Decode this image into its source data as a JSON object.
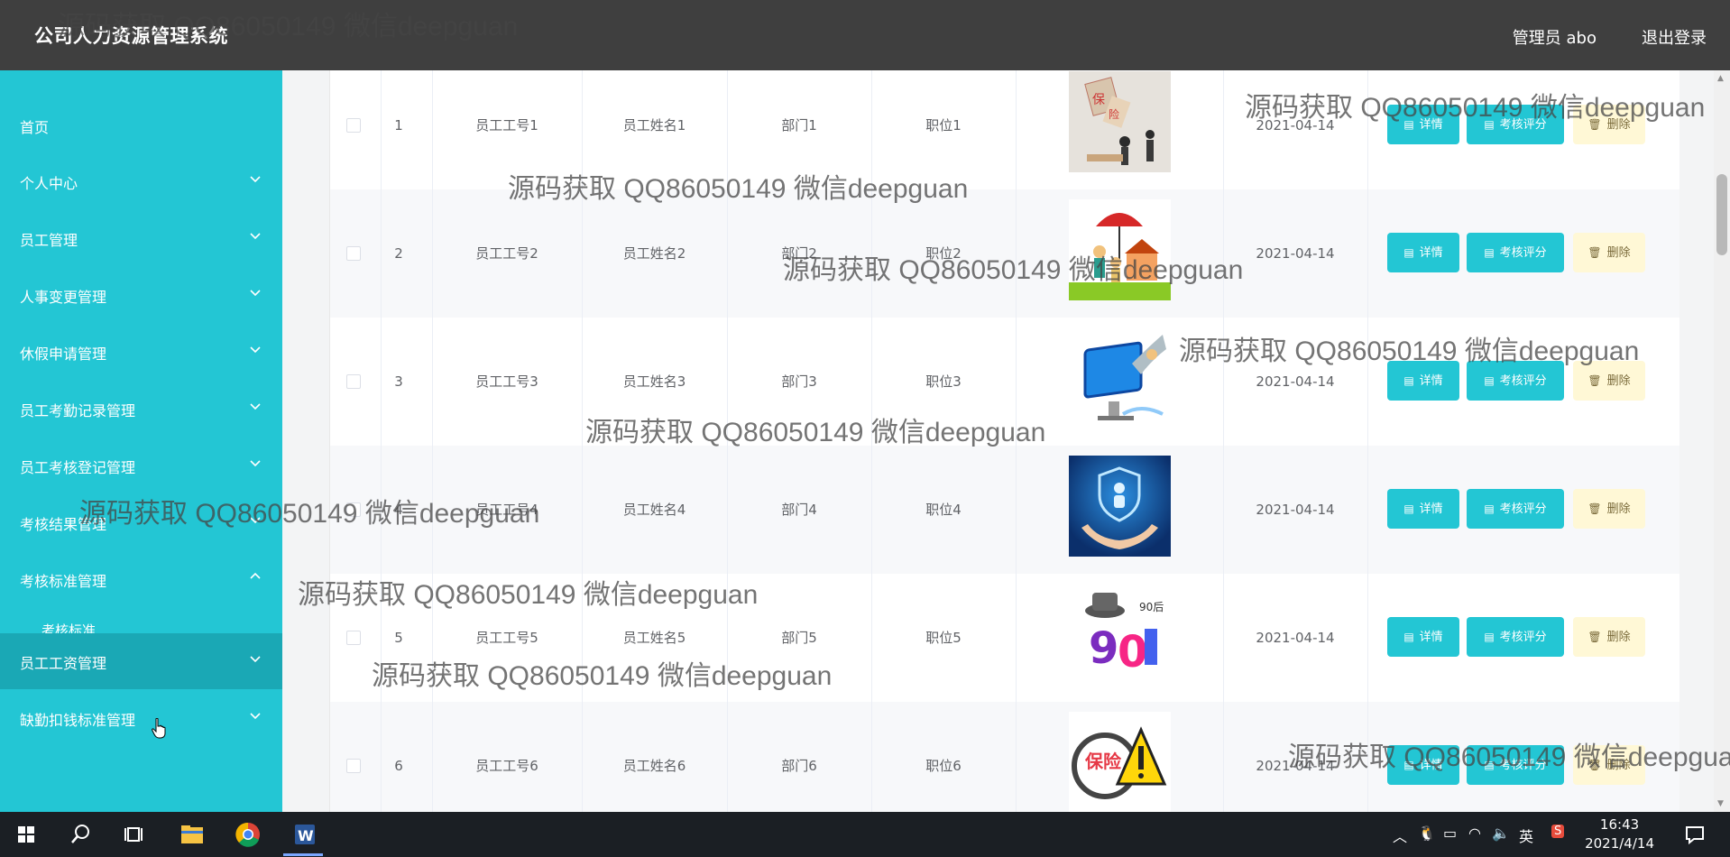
{
  "header": {
    "title": "公司人力资源管理系统",
    "user": "管理员 abo",
    "logout": "退出登录"
  },
  "sidebar": {
    "items": [
      {
        "label": "首页"
      },
      {
        "label": "个人中心"
      },
      {
        "label": "员工管理"
      },
      {
        "label": "人事变更管理"
      },
      {
        "label": "休假申请管理"
      },
      {
        "label": "员工考勤记录管理"
      },
      {
        "label": "员工考核登记管理"
      },
      {
        "label": "考核结果管理"
      },
      {
        "label": "考核标准管理"
      },
      {
        "label": "考核标准"
      },
      {
        "label": "员工工资管理"
      },
      {
        "label": "缺勤扣钱标准管理"
      }
    ]
  },
  "table": {
    "rows": [
      {
        "index": "1",
        "emp_no": "员工工号1",
        "name": "员工姓名1",
        "dept": "部门1",
        "position": "职位1",
        "date": "2021-04-14"
      },
      {
        "index": "2",
        "emp_no": "员工工号2",
        "name": "员工姓名2",
        "dept": "部门2",
        "position": "职位2",
        "date": "2021-04-14"
      },
      {
        "index": "3",
        "emp_no": "员工工号3",
        "name": "员工姓名3",
        "dept": "部门3",
        "position": "职位3",
        "date": "2021-04-14"
      },
      {
        "index": "4",
        "emp_no": "员工工号4",
        "name": "员工姓名4",
        "dept": "部门4",
        "position": "职位4",
        "date": "2021-04-14"
      },
      {
        "index": "5",
        "emp_no": "员工工号5",
        "name": "员工姓名5",
        "dept": "部门5",
        "position": "职位5",
        "date": "2021-04-14"
      },
      {
        "index": "6",
        "emp_no": "员工工号6",
        "name": "员工姓名6",
        "dept": "部门6",
        "position": "职位6",
        "date": "2021-04-14"
      }
    ],
    "actions": {
      "detail": "详情",
      "evaluate": "考核评分",
      "delete": "删除"
    }
  },
  "watermark": "源码获取 QQ86050149 微信deepguan",
  "taskbar": {
    "time": "16:43",
    "date": "2021/4/14",
    "ime": "英"
  },
  "colors": {
    "accent": "#23c6d4",
    "header": "#3f3f3f",
    "delete_bg": "#fff8d6"
  }
}
